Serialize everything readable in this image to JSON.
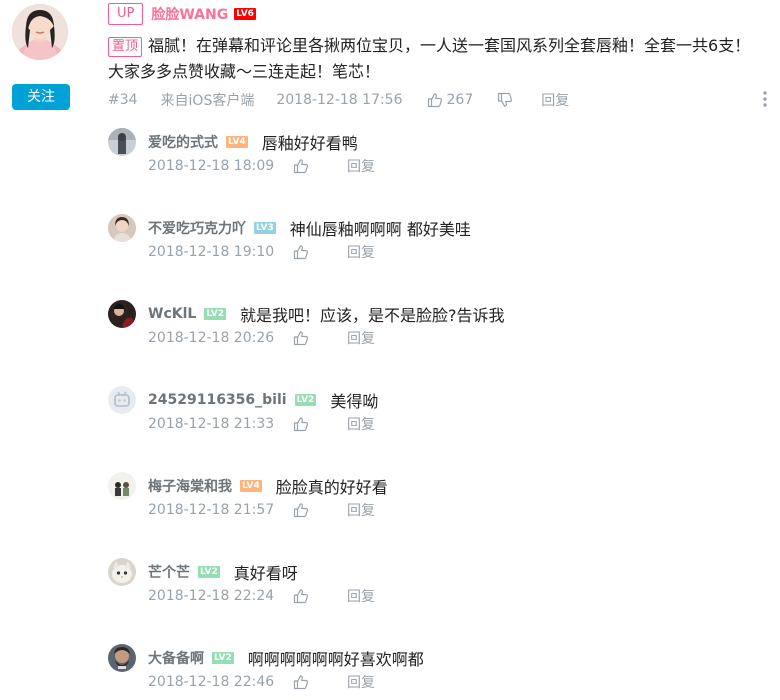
{
  "comment": {
    "up_badge": "UP",
    "username": "脸脸WANG",
    "level": "LV6",
    "pin_badge": "置顶",
    "text": "福腻！在弹幕和评论里各揪两位宝贝，一人送一套国风系列全套唇釉！全套一共6支！大家多多点赞收藏～三连走起！笔芯！",
    "floor": "#34",
    "source": "来自iOS客户端",
    "time": "2018-12-18 17:56",
    "likes": "267",
    "reply_label": "回复",
    "follow_label": "关注"
  },
  "replies": [
    {
      "username": "爱吃的式式",
      "level": "LV4",
      "level_color": "#ffb37c",
      "text": "唇釉好好看鸭",
      "time": "2018-12-18 18:09",
      "reply_label": "回复"
    },
    {
      "username": "不爱吃巧克力吖",
      "level": "LV3",
      "level_color": "#92d1e5",
      "text": "神仙唇釉啊啊啊 都好美哇",
      "time": "2018-12-18 19:10",
      "reply_label": "回复"
    },
    {
      "username": "WcKlL",
      "level": "LV2",
      "level_color": "#95ddb2",
      "text": "就是我吧！应该，是不是脸脸?告诉我",
      "time": "2018-12-18 20:26",
      "reply_label": "回复"
    },
    {
      "username": "24529116356_bili",
      "level": "LV2",
      "level_color": "#95ddb2",
      "text": "美得呦",
      "time": "2018-12-18 21:33",
      "reply_label": "回复"
    },
    {
      "username": "梅子海棠和我",
      "level": "LV4",
      "level_color": "#ffb37c",
      "text": "脸脸真的好好看",
      "time": "2018-12-18 21:57",
      "reply_label": "回复"
    },
    {
      "username": "芒个芒",
      "level": "LV2",
      "level_color": "#95ddb2",
      "text": "真好看呀",
      "time": "2018-12-18 22:24",
      "reply_label": "回复"
    },
    {
      "username": "大备备啊",
      "level": "LV2",
      "level_color": "#95ddb2",
      "text": "啊啊啊啊啊啊好喜欢啊都",
      "time": "2018-12-18 22:46",
      "reply_label": "回复"
    }
  ],
  "icons": {
    "like": "thumb-up-icon",
    "dislike": "thumb-down-icon",
    "more": "more-vertical-icon"
  },
  "colors": {
    "accent": "#00a1d6",
    "pink": "#fb7299",
    "meta": "#99a2aa"
  }
}
